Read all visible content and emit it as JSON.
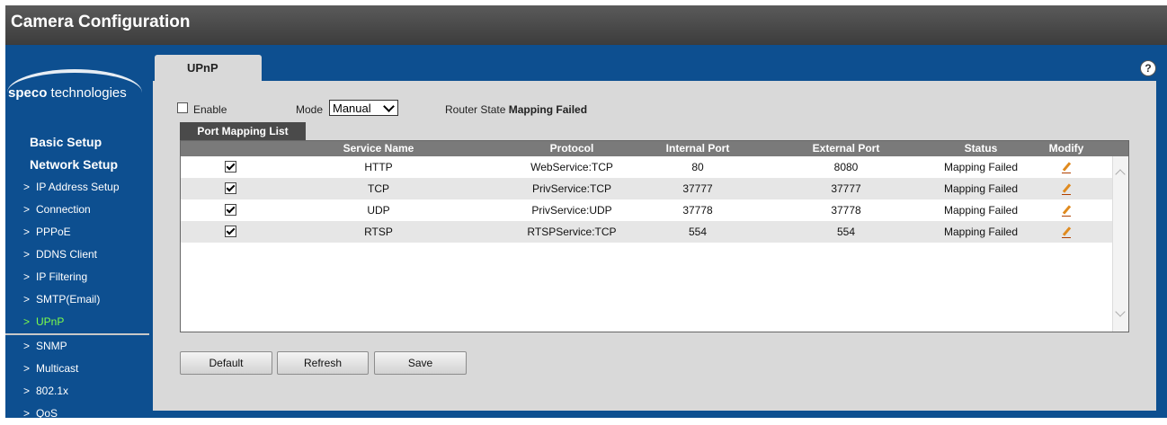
{
  "app": {
    "title": "Camera Configuration"
  },
  "logo": {
    "brand": "speco",
    "suffix": " technologies"
  },
  "nav": {
    "categories": [
      "Basic Setup",
      "Network Setup"
    ],
    "items": [
      {
        "label": "IP Address Setup"
      },
      {
        "label": "Connection"
      },
      {
        "label": "PPPoE"
      },
      {
        "label": "DDNS Client"
      },
      {
        "label": "IP Filtering"
      },
      {
        "label": "SMTP(Email)"
      },
      {
        "label": "UPnP"
      },
      {
        "label": "SNMP"
      },
      {
        "label": "Multicast"
      },
      {
        "label": "802.1x"
      },
      {
        "label": "QoS"
      }
    ]
  },
  "tab": {
    "label": "UPnP"
  },
  "help": {
    "symbol": "?"
  },
  "settings": {
    "enable_label": "Enable",
    "mode_label": "Mode",
    "mode_value": "Manual",
    "router_state_label": "Router State",
    "router_state_value": "Mapping Failed"
  },
  "port_mapping": {
    "tab_label": "Port Mapping List",
    "headers": [
      "",
      "Service Name",
      "Protocol",
      "Internal Port",
      "External Port",
      "Status",
      "Modify"
    ],
    "rows": [
      {
        "service": "HTTP",
        "protocol": "WebService:TCP",
        "internal": "80",
        "external": "8080",
        "status": "Mapping Failed"
      },
      {
        "service": "TCP",
        "protocol": "PrivService:TCP",
        "internal": "37777",
        "external": "37777",
        "status": "Mapping Failed"
      },
      {
        "service": "UDP",
        "protocol": "PrivService:UDP",
        "internal": "37778",
        "external": "37778",
        "status": "Mapping Failed"
      },
      {
        "service": "RTSP",
        "protocol": "RTSPService:TCP",
        "internal": "554",
        "external": "554",
        "status": "Mapping Failed"
      }
    ]
  },
  "buttons": {
    "default": "Default",
    "refresh": "Refresh",
    "save": "Save"
  }
}
